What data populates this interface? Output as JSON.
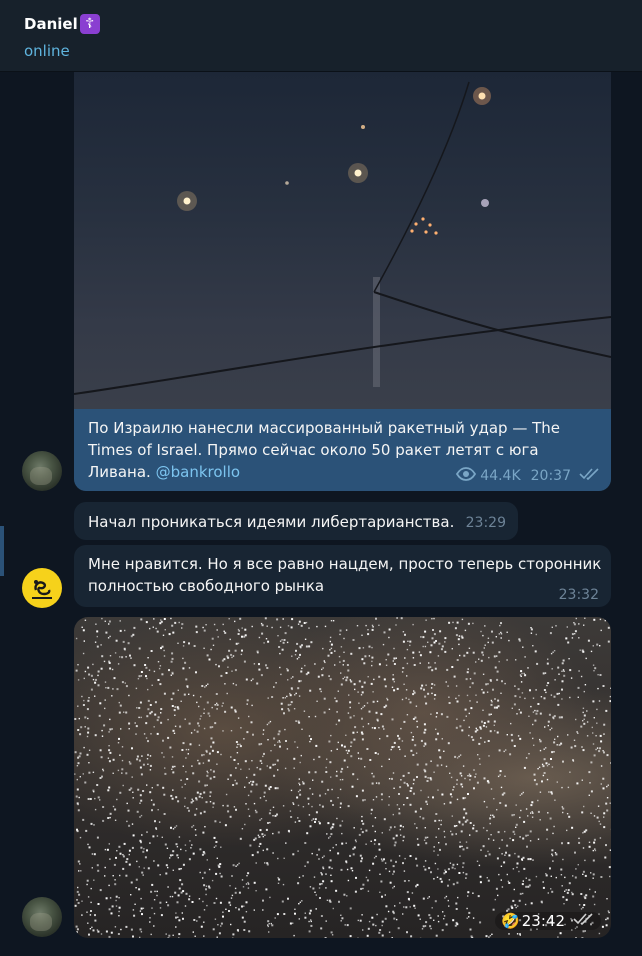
{
  "header": {
    "name": "Daniel",
    "name_emoji": "☦",
    "status": "online"
  },
  "messages": [
    {
      "type": "video",
      "caption_text": "По Израилю нанесли массированный ракетный удар — The Times of Israel. Прямо сейчас около 50 ракет летят с юга Ливана.",
      "caption_link": "@bankrollo",
      "views": "44.4K",
      "time": "20:37",
      "read_status": "read"
    },
    {
      "type": "text",
      "text": "Начал проникаться идеями либертарианства.",
      "time": "23:29"
    },
    {
      "type": "text",
      "text": "Мне нравится. Но я все равно нацдем, просто теперь сторонник полностью свободного рынка",
      "time": "23:32"
    },
    {
      "type": "photo",
      "reaction": "🤣",
      "time": "23:42",
      "read_status": "read"
    }
  ],
  "icons": {
    "views": "eye-icon",
    "read": "double-check-icon"
  },
  "colors": {
    "background": "#0e1621",
    "header": "#17212b",
    "bubble": "#182533",
    "caption_bg": "#2b5278",
    "accent": "#5fb4de",
    "link": "#7cc4ef"
  }
}
